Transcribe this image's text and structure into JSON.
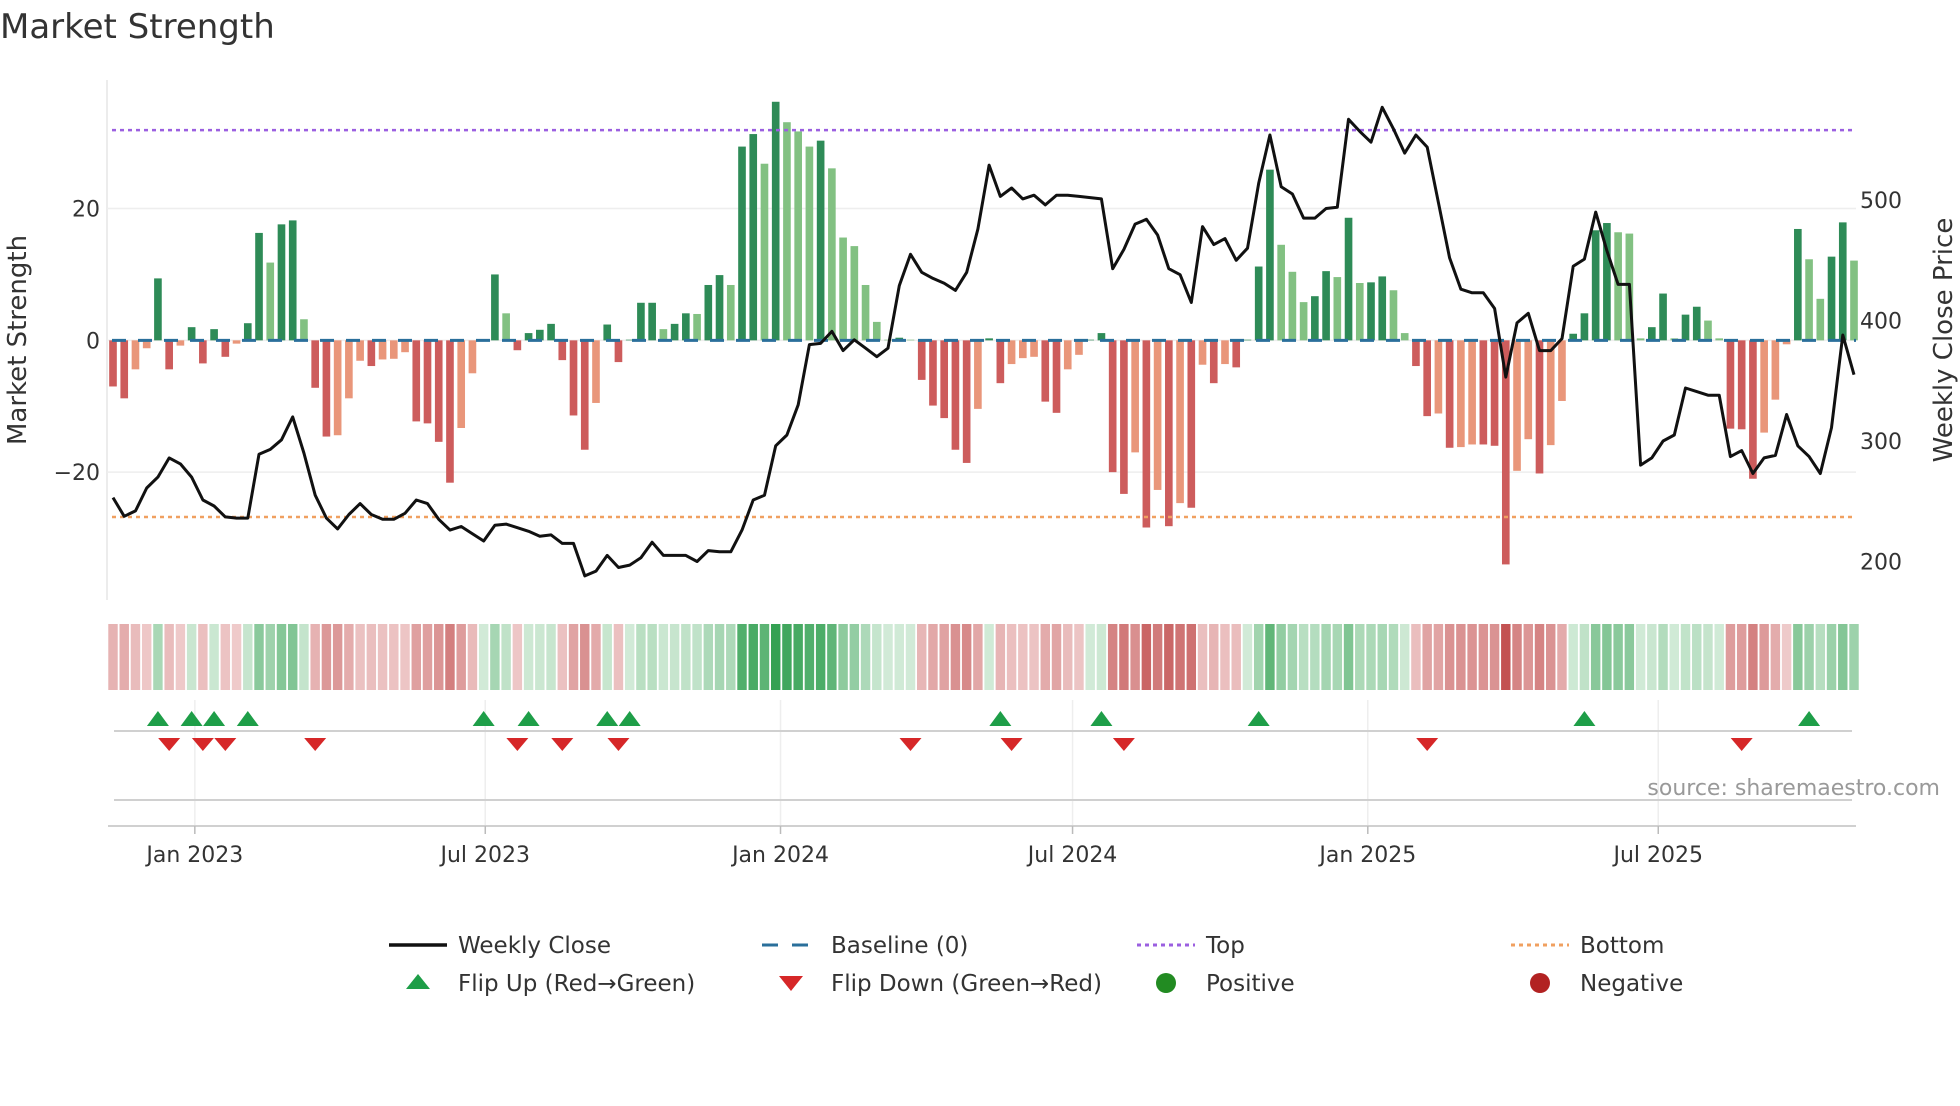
{
  "chart_data": {
    "type": "bar",
    "title": "Market Strength",
    "ylabel": "Market Strength",
    "y2label": "Weekly Close Price",
    "start_date": "2022-11-11",
    "frequency": "weekly",
    "ylim": [
      -39.4,
      39.2
    ],
    "y2lim": [
      168,
      598
    ],
    "yticks": [
      {
        "v": 20,
        "label": "20"
      },
      {
        "v": 0,
        "label": "0"
      },
      {
        "v": -20,
        "label": "−20"
      }
    ],
    "y2ticks": [
      {
        "v": 500,
        "label": "500"
      },
      {
        "v": 400,
        "label": "400"
      },
      {
        "v": 300,
        "label": "300"
      },
      {
        "v": 200,
        "label": "200"
      }
    ],
    "xticks": [
      {
        "date": "2023-01-01",
        "label": "Jan 2023"
      },
      {
        "date": "2023-07-01",
        "label": "Jul 2023"
      },
      {
        "date": "2024-01-01",
        "label": "Jan 2024"
      },
      {
        "date": "2024-07-01",
        "label": "Jul 2024"
      },
      {
        "date": "2025-01-01",
        "label": "Jan 2025"
      },
      {
        "date": "2025-07-01",
        "label": "Jul 2025"
      }
    ],
    "top_level": 31.9,
    "bottom_level": -26.8,
    "baseline": 0,
    "strength": [
      -7,
      -8.8,
      -4.4,
      -1.2,
      9.4,
      -4.4,
      -0.8,
      2,
      -3.5,
      1.7,
      -2.5,
      -0.5,
      2.6,
      16.3,
      11.8,
      17.6,
      18.2,
      3.2,
      -7.2,
      -14.6,
      -14.4,
      -8.8,
      -3.1,
      -3.9,
      -2.9,
      -2.8,
      -1.8,
      -12.3,
      -12.6,
      -15.4,
      -21.6,
      -13.3,
      -5,
      0.1,
      10,
      4.1,
      -1.5,
      1.1,
      1.6,
      2.5,
      -3,
      -11.4,
      -16.6,
      -9.5,
      2.4,
      -3.3,
      0.1,
      5.7,
      5.7,
      1.7,
      2.5,
      4.1,
      4.0,
      8.4,
      9.9,
      8.4,
      29.4,
      31.3,
      26.8,
      36.2,
      33.1,
      31.7,
      29.4,
      30.3,
      26.1,
      15.6,
      14.3,
      8.4,
      2.8,
      0.1,
      0.4,
      0.1,
      -6,
      -9.9,
      -11.8,
      -16.6,
      -18.6,
      -10.4,
      0.3,
      -6.5,
      -3.6,
      -2.7,
      -2.5,
      -9.3,
      -11,
      -4.4,
      -2.2,
      0.1,
      1.1,
      -20,
      -23.3,
      -17,
      -28.4,
      -22.7,
      -28.2,
      -24.7,
      -25.4,
      -3.7,
      -6.5,
      -3.6,
      -4.1,
      0.1,
      11.2,
      25.9,
      14.5,
      10.4,
      5.8,
      6.7,
      10.5,
      9.6,
      18.6,
      8.7,
      8.8,
      9.7,
      7.6,
      1.1,
      -3.9,
      -11.5,
      -11.1,
      -16.3,
      -16.2,
      -15.8,
      -15.8,
      -16,
      -34,
      -19.8,
      -15,
      -20.2,
      -15.9,
      -9.2,
      1,
      4.1,
      16.7,
      17.8,
      16.4,
      16.2,
      0.3,
      2,
      7.1,
      0.3,
      3.9,
      5.1,
      3,
      0.3,
      -13.4,
      -13.5,
      -21,
      -14,
      -9,
      -0.6,
      16.9,
      12.3,
      6.3,
      12.7,
      17.9,
      12.1
    ],
    "weekly_close": [
      253,
      237.5,
      242,
      261,
      270,
      286,
      281,
      270,
      251,
      246,
      237,
      236,
      236,
      289,
      293,
      301,
      320,
      290,
      255,
      236,
      227,
      239,
      248,
      239,
      235,
      235,
      240,
      251,
      248,
      235,
      226,
      229,
      223,
      217,
      230,
      231,
      228,
      225,
      221,
      222,
      215,
      215,
      188,
      192,
      205,
      195,
      197,
      203,
      216,
      205,
      205,
      205,
      200,
      209,
      208,
      208,
      226,
      251,
      255,
      296,
      305,
      330,
      380,
      381,
      391,
      375,
      384,
      377,
      370,
      377,
      429,
      455,
      440,
      435,
      431,
      425,
      440,
      476,
      529,
      503,
      510,
      501,
      504,
      496,
      504,
      504,
      503,
      502,
      501,
      443,
      459,
      480,
      484,
      471,
      443,
      438,
      415,
      478,
      463,
      468,
      450,
      460,
      514,
      554,
      511,
      505,
      485,
      485,
      493,
      494,
      567,
      557,
      548,
      577,
      559,
      539,
      554,
      544,
      498,
      452,
      426,
      423,
      423,
      410,
      353,
      398,
      406,
      375,
      375,
      385,
      445,
      451,
      490,
      458,
      430,
      430,
      280,
      286,
      300,
      305,
      344,
      341,
      338,
      338,
      287,
      292,
      273,
      286,
      288,
      322,
      296,
      287,
      273,
      311,
      388,
      355
    ],
    "flip_up_index": [
      4,
      7,
      9,
      12,
      33,
      37,
      44,
      46,
      79,
      88,
      102,
      131,
      151
    ],
    "flip_down_index": [
      5,
      8,
      10,
      18,
      36,
      40,
      45,
      71,
      80,
      90,
      117,
      145
    ],
    "legend": [
      {
        "label": "Weekly Close",
        "kind": "line",
        "color": "#111111"
      },
      {
        "label": "Baseline (0)",
        "kind": "dash",
        "color": "#2a6f9b"
      },
      {
        "label": "Top",
        "kind": "dot",
        "color": "#9b5fe0"
      },
      {
        "label": "Bottom",
        "kind": "dot",
        "color": "#f0a060"
      },
      {
        "label": "Flip Up (Red→Green)",
        "kind": "tri-up",
        "color": "#1e9e48"
      },
      {
        "label": "Flip Down (Green→Red)",
        "kind": "tri-down",
        "color": "#d62728"
      },
      {
        "label": "Positive",
        "kind": "circle",
        "color": "#228b22"
      },
      {
        "label": "Negative",
        "kind": "circle",
        "color": "#b22222"
      }
    ],
    "legend_placement": "bottom",
    "source": "source: sharemaestro.com",
    "colors": {
      "pos_up": "#2e8b57",
      "pos_down": "#82c182",
      "neg_down": "#cd5c5c",
      "neg_up": "#e9967a"
    }
  }
}
